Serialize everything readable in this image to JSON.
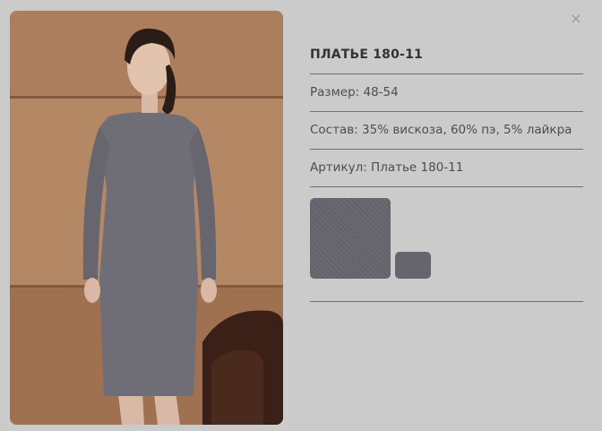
{
  "close": {
    "glyph": "×"
  },
  "product": {
    "title": "ПЛАТЬЕ 180-11",
    "size": "Размер: 48-54",
    "composition": "Состав: 35% вискоза, 60% пэ, 5% лайкра",
    "article": "Артикул: Платье 180-11"
  },
  "colors": {
    "swatch": "#66656e",
    "background": "#cbcbcb"
  }
}
